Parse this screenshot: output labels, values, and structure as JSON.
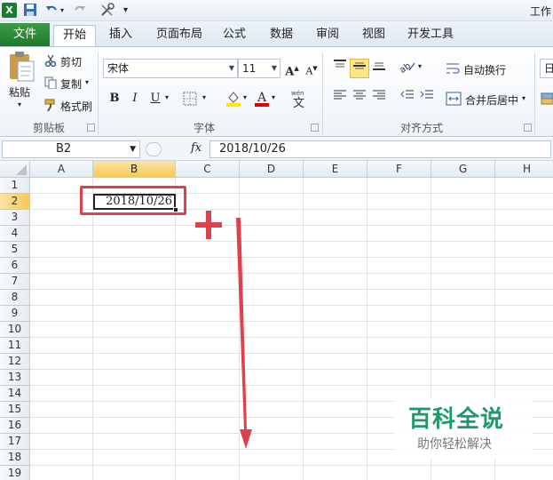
{
  "title_bar": {
    "title": "工作"
  },
  "ribbon_tabs": {
    "file": "文件",
    "home": "开始",
    "insert": "插入",
    "page_layout": "页面布局",
    "formulas": "公式",
    "data": "数据",
    "review": "审阅",
    "view": "视图",
    "developer": "开发工具"
  },
  "clipboard": {
    "paste": "粘贴",
    "cut": "剪切",
    "copy": "复制",
    "format_painter": "格式刷",
    "group_label": "剪贴板"
  },
  "font": {
    "name": "宋体",
    "size": "11",
    "bold": "B",
    "italic": "I",
    "underline": "U",
    "group_label": "字体"
  },
  "alignment": {
    "wrap_text": "自动换行",
    "merge_center": "合并后居中",
    "group_label": "对齐方式",
    "next_group_partial": "日"
  },
  "formula_bar": {
    "name_box": "B2",
    "fx": "fx",
    "value": "2018/10/26"
  },
  "grid": {
    "columns": [
      "A",
      "B",
      "C",
      "D",
      "E",
      "F",
      "G",
      "H"
    ],
    "rows": [
      "1",
      "2",
      "3",
      "4",
      "5",
      "6",
      "7",
      "8",
      "9",
      "10",
      "11",
      "12",
      "13",
      "14",
      "15",
      "16",
      "17",
      "18",
      "19"
    ],
    "selected_column": "B",
    "selected_row": "2",
    "active_cell_value": "2018/10/26"
  },
  "watermark": {
    "title": "百科全说",
    "subtitle": "助你轻松解决"
  },
  "colors": {
    "file_tab": "#2a8a37",
    "annotation_red": "#e0404a",
    "selection_header": "#f5c85a"
  }
}
